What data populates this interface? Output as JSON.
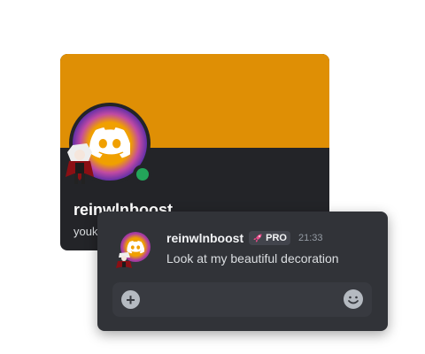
{
  "profile_card": {
    "username": "reinwlnboost",
    "pronoun": "youk",
    "status": "online",
    "banner_color": "#df8f05"
  },
  "message": {
    "author": "reinwlnboost",
    "badge": "PRO",
    "time": "21:33",
    "text": "Look at my beautiful decoration"
  },
  "composer": {
    "add_icon": "plus-circle-icon",
    "emoji_icon": "smiley-icon"
  }
}
